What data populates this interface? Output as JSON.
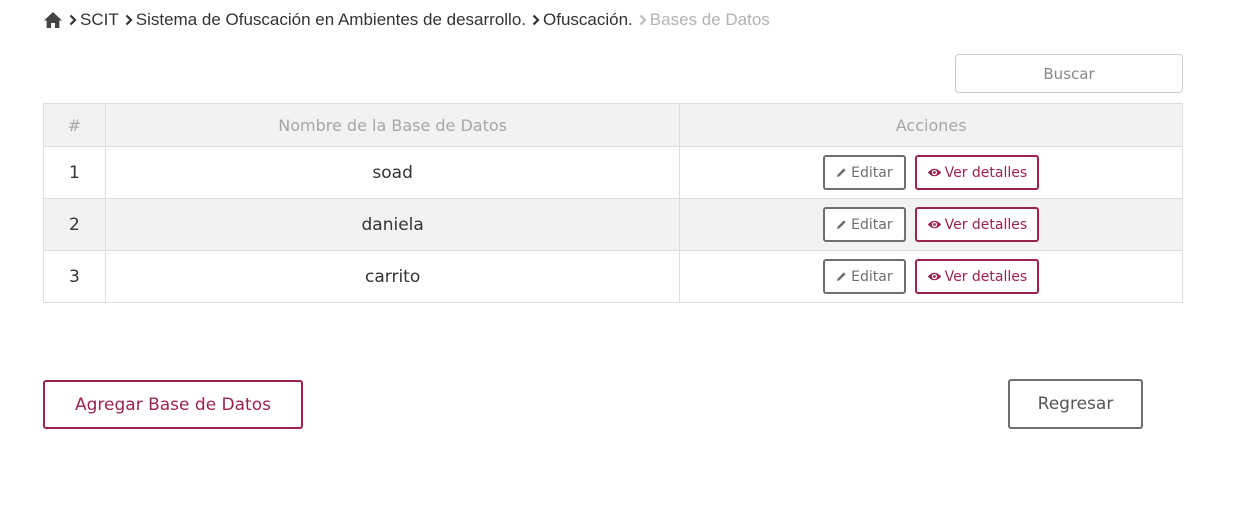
{
  "breadcrumb": {
    "home_icon": "home-icon",
    "separator_icon": "chevron-right-icon",
    "items": [
      "SCIT",
      "Sistema de Ofuscación en Ambientes de desarrollo.",
      "Ofuscación.",
      "Bases de Datos"
    ]
  },
  "search": {
    "placeholder": "Buscar",
    "value": ""
  },
  "table": {
    "headers": [
      "#",
      "Nombre de la Base de Datos",
      "Acciones"
    ],
    "rows": [
      {
        "num": "1",
        "name": "soad"
      },
      {
        "num": "2",
        "name": "daniela"
      },
      {
        "num": "3",
        "name": "carrito"
      }
    ],
    "edit_label": "Editar",
    "edit_icon": "pencil-icon",
    "view_label": "Ver detalles",
    "view_icon": "eye-icon"
  },
  "footer": {
    "add_label": "Agregar Base de Datos",
    "back_label": "Regresar"
  },
  "colors": {
    "accent": "#9d2449",
    "neutral_border": "#6f6f6f",
    "header_bg": "#f2f2f2",
    "muted_text": "#b3b3b3"
  }
}
